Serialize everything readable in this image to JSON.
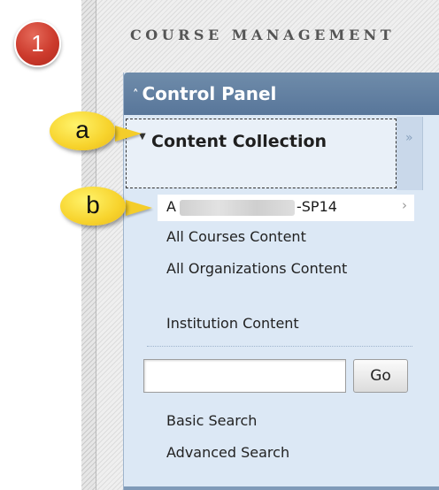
{
  "badge": {
    "number": "1"
  },
  "header": {
    "section_title": "COURSE MANAGEMENT"
  },
  "control_panel": {
    "title": "Control Panel",
    "collapse_glyph": "˄",
    "content_collection": {
      "label": "Content Collection",
      "expand_glyph": "»"
    },
    "items": [
      {
        "label_start": "A",
        "label_end": "-SP14",
        "chevron": "›"
      },
      {
        "label": "All Courses Content"
      },
      {
        "label": "All Organizations Content"
      },
      {
        "label": "Institution Content"
      }
    ],
    "search": {
      "input_value": "",
      "go_label": "Go"
    },
    "links": [
      {
        "label": "Basic Search"
      },
      {
        "label": "Advanced Search"
      }
    ]
  },
  "callouts": {
    "a": "a",
    "b": "b"
  },
  "colors": {
    "badge_red": "#cc3a2c",
    "callout_yellow": "#f7d32c",
    "panel_header": "#58769a",
    "panel_bg": "#dce8f5"
  }
}
